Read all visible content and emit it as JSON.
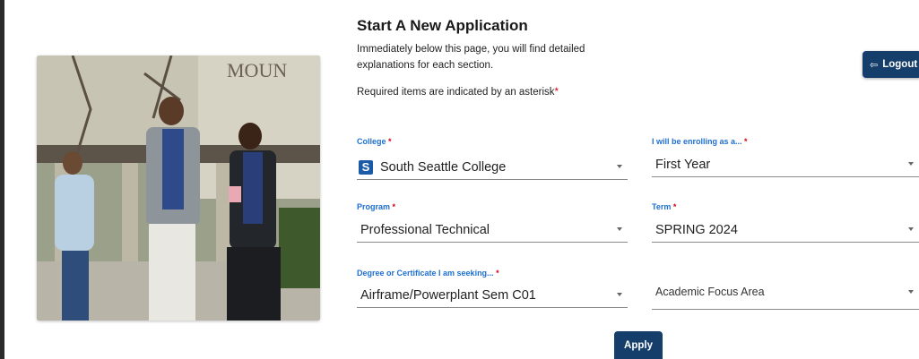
{
  "header": {
    "title": "Start A New Application",
    "intro": "Immediately below this page, you will find detailed explanations for each section.",
    "required_note": "Required items are indicated by an asterisk",
    "asterisk": "*"
  },
  "logout": {
    "label": "Logout",
    "icon": "logout-icon"
  },
  "photo": {
    "sign_text": "MOUN"
  },
  "form": {
    "college": {
      "label": "College",
      "value": "South Seattle College",
      "logo_letter": "S"
    },
    "enrolling_as": {
      "label": "I will be enrolling as a...",
      "value": "First Year"
    },
    "program": {
      "label": "Program",
      "value": "Professional Technical"
    },
    "term": {
      "label": "Term",
      "value": "SPRING 2024"
    },
    "degree": {
      "label": "Degree or Certificate I am seeking...",
      "value": "Airframe/Powerplant Sem C01"
    },
    "focus_area": {
      "label": "",
      "placeholder": "Academic Focus Area"
    }
  },
  "apply_label": "Apply",
  "colors": {
    "primary": "#153e6b",
    "label_blue": "#1e6fd0",
    "required_red": "#d0021b"
  }
}
